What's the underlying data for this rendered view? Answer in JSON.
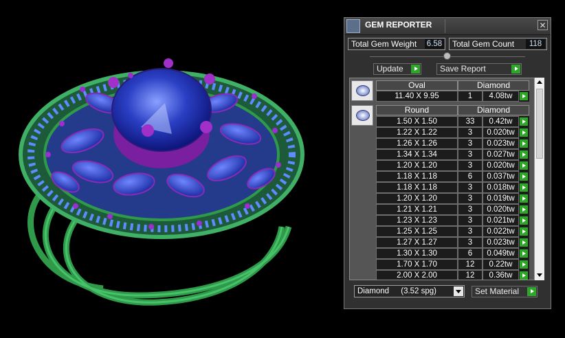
{
  "window": {
    "title": "GEM REPORTER",
    "close_glyph": "✕"
  },
  "stats": {
    "weight_label": "Total Gem Weight",
    "weight_value": "6.58",
    "count_label": "Total Gem Count",
    "count_value": "118"
  },
  "buttons": {
    "update": "Update",
    "save_report": "Save Report",
    "set_material": "Set Material"
  },
  "groups": [
    {
      "shape": "Oval",
      "material": "Diamond",
      "icon": "oval-gem-icon",
      "rows": [
        {
          "size": "11.40 X 9.95",
          "count": "1",
          "weight": "4.08tw"
        }
      ]
    },
    {
      "shape": "Round",
      "material": "Diamond",
      "icon": "round-gem-icon",
      "rows": [
        {
          "size": "1.50 X 1.50",
          "count": "33",
          "weight": "0.42tw"
        },
        {
          "size": "1.22 X 1.22",
          "count": "3",
          "weight": "0.020tw"
        },
        {
          "size": "1.26 X 1.26",
          "count": "3",
          "weight": "0.023tw"
        },
        {
          "size": "1.34 X 1.34",
          "count": "3",
          "weight": "0.027tw"
        },
        {
          "size": "1.20 X 1.20",
          "count": "3",
          "weight": "0.020tw"
        },
        {
          "size": "1.18 X 1.18",
          "count": "6",
          "weight": "0.037tw"
        },
        {
          "size": "1.18 X 1.18",
          "count": "3",
          "weight": "0.018tw"
        },
        {
          "size": "1.20 X 1.20",
          "count": "3",
          "weight": "0.019tw"
        },
        {
          "size": "1.21 X 1.21",
          "count": "3",
          "weight": "0.020tw"
        },
        {
          "size": "1.23 X 1.23",
          "count": "3",
          "weight": "0.021tw"
        },
        {
          "size": "1.25 X 1.25",
          "count": "3",
          "weight": "0.022tw"
        },
        {
          "size": "1.27 X 1.27",
          "count": "3",
          "weight": "0.023tw"
        },
        {
          "size": "1.30 X 1.30",
          "count": "6",
          "weight": "0.049tw"
        },
        {
          "size": "1.70 X 1.70",
          "count": "12",
          "weight": "0.22tw"
        },
        {
          "size": "2.00 X 2.00",
          "count": "12",
          "weight": "0.36tw"
        }
      ]
    }
  ],
  "material_select": {
    "value": "Diamond",
    "spg": "(3.52 spg)"
  },
  "colors": {
    "accent_green": "#2fa62a",
    "metal_green": "#2e9a4a",
    "gem_blue": "#2a3fc4",
    "prong_purple": "#7a1fa0"
  }
}
